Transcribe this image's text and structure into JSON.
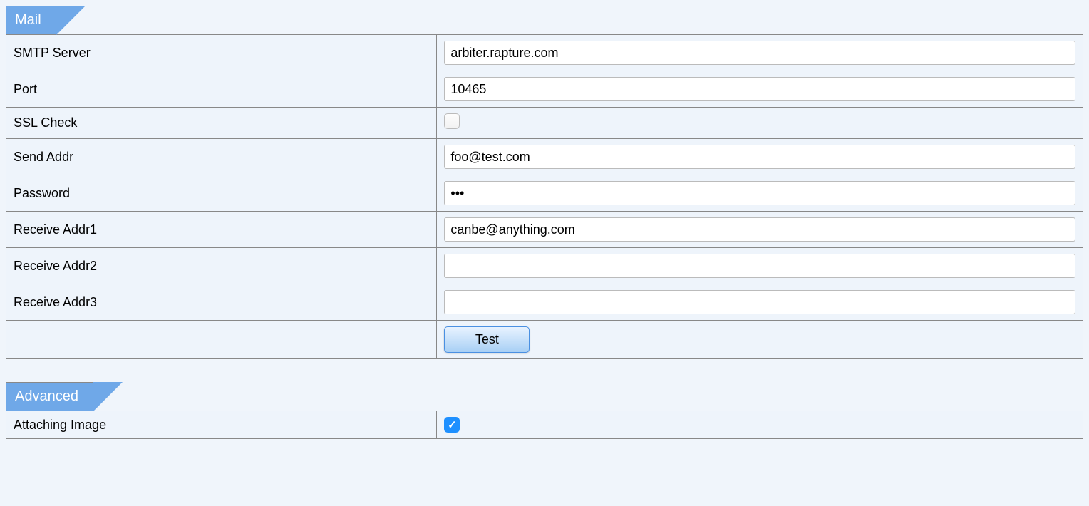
{
  "mail": {
    "section_title": "Mail",
    "fields": {
      "smtp_server": {
        "label": "SMTP Server",
        "value": "arbiter.rapture.com"
      },
      "port": {
        "label": "Port",
        "value": "10465"
      },
      "ssl_check": {
        "label": "SSL Check",
        "checked": false
      },
      "send_addr": {
        "label": "Send Addr",
        "value": "foo@test.com"
      },
      "password": {
        "label": "Password",
        "value": "•••"
      },
      "receive_addr1": {
        "label": "Receive Addr1",
        "value": "canbe@anything.com"
      },
      "receive_addr2": {
        "label": "Receive Addr2",
        "value": ""
      },
      "receive_addr3": {
        "label": "Receive Addr3",
        "value": ""
      }
    },
    "test_button": "Test"
  },
  "advanced": {
    "section_title": "Advanced",
    "fields": {
      "attaching_image": {
        "label": "Attaching Image",
        "checked": true
      }
    }
  }
}
